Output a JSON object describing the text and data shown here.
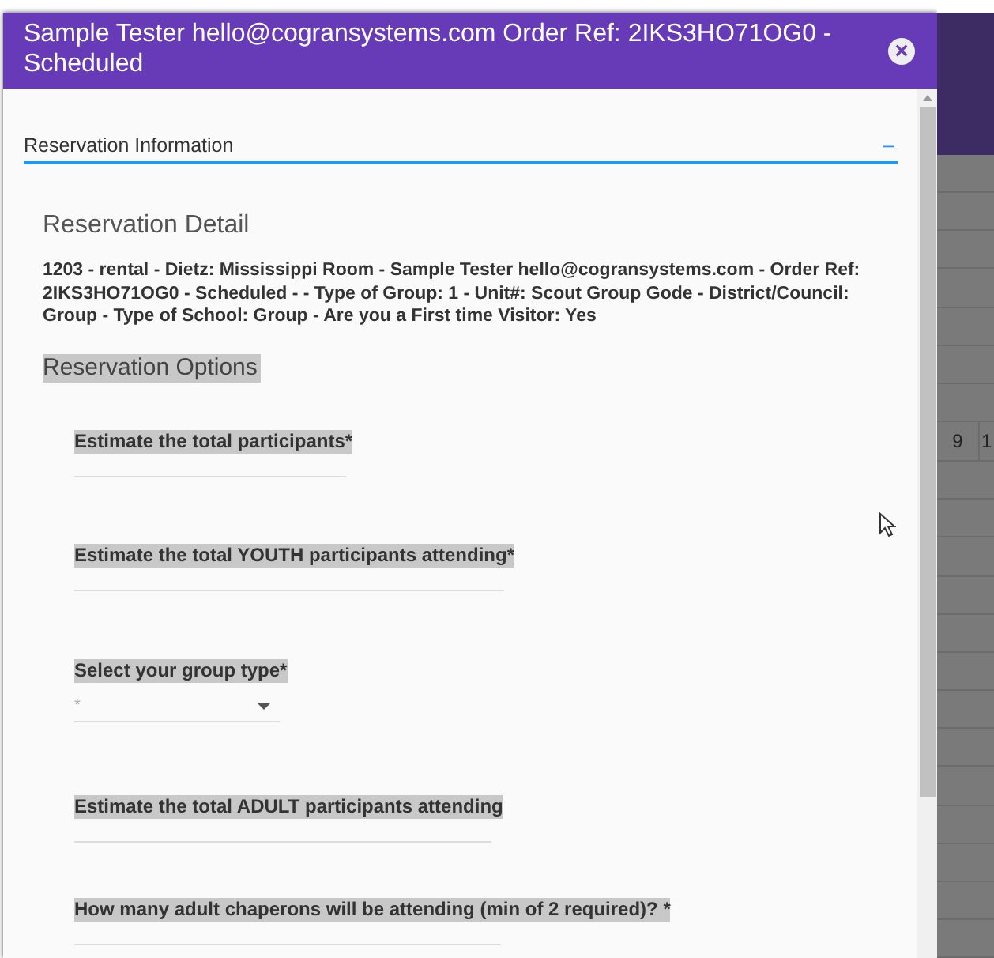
{
  "dialog": {
    "title": "Sample Tester hello@cogransystems.com Order Ref: 2IKS3HO71OG0 - Scheduled",
    "close_icon": "×"
  },
  "section": {
    "title": "Reservation Information",
    "toggle": "–",
    "expanded": true
  },
  "detail": {
    "heading": "Reservation Detail",
    "text": "1203 - rental - Dietz: Mississippi Room - Sample Tester hello@cogransystems.com - Order Ref: 2IKS3HO71OG0 - Scheduled - - Type of Group: 1 - Unit#: Scout Group Gode - District/Council: Group - Type of School: Group - Are you a First time Visitor: Yes"
  },
  "options": {
    "heading": "Reservation Options",
    "fields": [
      {
        "kind": "text",
        "label": "Estimate the total participants*"
      },
      {
        "kind": "text",
        "label": "Estimate the total YOUTH participants attending*"
      },
      {
        "kind": "select",
        "label": "Select your group type*",
        "placeholder": "*"
      },
      {
        "kind": "text",
        "label": "Estimate the total ADULT participants attending"
      },
      {
        "kind": "text",
        "label": "How many adult chaperons will be attending (min of 2 required)? *"
      }
    ]
  },
  "background": {
    "cells": [
      "9",
      "1"
    ]
  }
}
